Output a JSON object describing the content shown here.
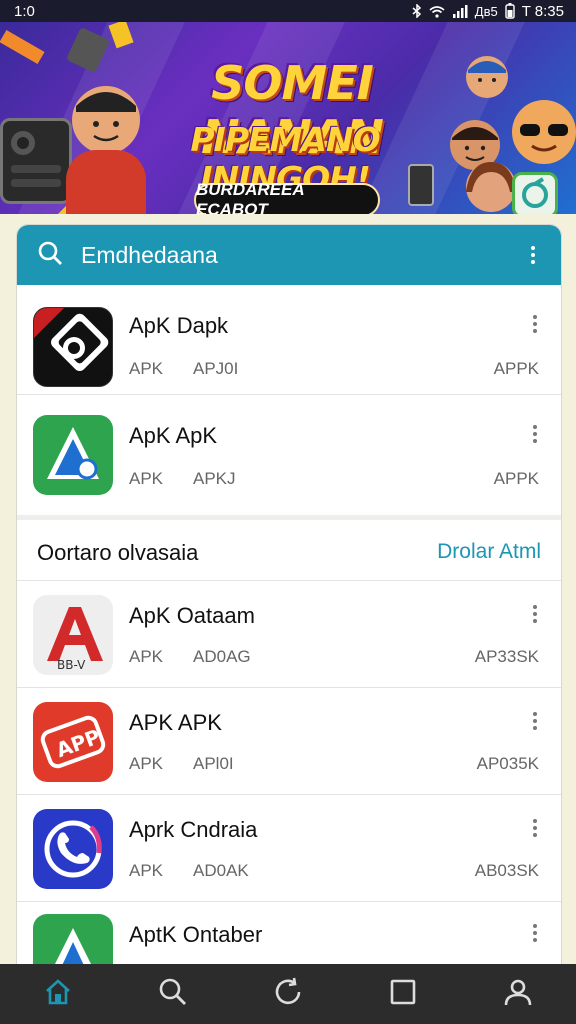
{
  "status_bar": {
    "time": "1:0",
    "right_text": "Дв5",
    "clock": "T 8:35",
    "icons": [
      "bluetooth-icon",
      "wifi-icon",
      "signal-icon",
      "battery-icon"
    ]
  },
  "banner": {
    "headline1": "SOMEI NANAN",
    "headline2": "PIPEMANO ININGOH!",
    "pill_label": "BURDAREEA ECABOT",
    "colors": {
      "headline": "#ffd43a",
      "pill": "#111111"
    }
  },
  "search": {
    "label": "Emdhedaana",
    "icon": "search-icon",
    "menu_icon": "more-vert-icon"
  },
  "top_apps": [
    {
      "name": "ApK Dapk",
      "meta1": "APK",
      "meta2": "APJ0I",
      "meta3": "APPK",
      "icon": "target-app-icon"
    },
    {
      "name": "ApK ApK",
      "meta1": "APK",
      "meta2": "APKJ",
      "meta3": "APPK",
      "icon": "triangle-app-icon"
    }
  ],
  "section": {
    "title": "Oortaro olvasaia",
    "link": "Drolar Atml"
  },
  "section_apps": [
    {
      "name": "ApK Oataam",
      "meta1": "APK",
      "meta2": "AD0AG",
      "meta3": "AP33SK",
      "icon": "a-letter-app-icon"
    },
    {
      "name": "APK APK",
      "meta1": "APK",
      "meta2": "APl0I",
      "meta3": "AP035K",
      "icon": "app-badge-icon"
    },
    {
      "name": "Aprk Cndraia",
      "meta1": "APK",
      "meta2": "AD0AK",
      "meta3": "AB03SK",
      "icon": "phone-app-icon"
    },
    {
      "name": "AptK Ontaber",
      "icon": "triangle-green-app-icon"
    }
  ],
  "bottom_nav": [
    {
      "name": "home-icon",
      "active": true
    },
    {
      "name": "search-icon",
      "active": false
    },
    {
      "name": "refresh-icon",
      "active": false
    },
    {
      "name": "square-icon",
      "active": false
    },
    {
      "name": "profile-icon",
      "active": false
    }
  ],
  "colors": {
    "accent": "#1d96b4",
    "nav_bg": "#2c2c2c",
    "active_nav": "#1d96b4"
  }
}
